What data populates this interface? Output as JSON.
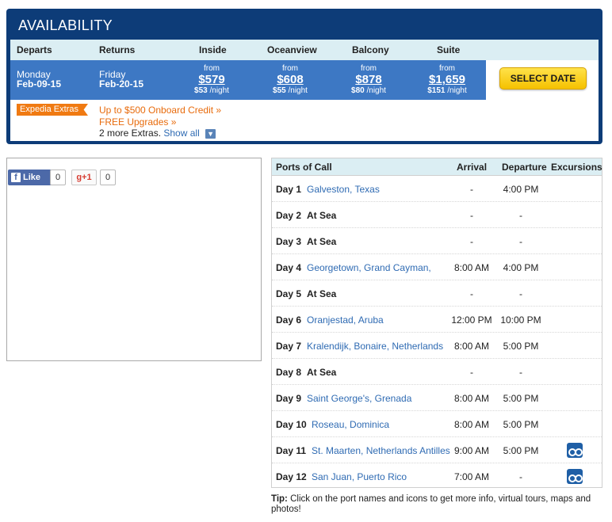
{
  "availability": {
    "title": "AVAILABILITY",
    "headers": {
      "departs": "Departs",
      "returns": "Returns",
      "inside": "Inside",
      "oceanview": "Oceanview",
      "balcony": "Balcony",
      "suite": "Suite"
    },
    "departs_day": "Monday",
    "departs_date": "Feb-09-15",
    "returns_day": "Friday",
    "returns_date": "Feb-20-15",
    "prices": [
      {
        "from": "from",
        "amount": "$579",
        "per_night_amount": "$53",
        "per_night_label": "/night"
      },
      {
        "from": "from",
        "amount": "$608",
        "per_night_amount": "$55",
        "per_night_label": "/night"
      },
      {
        "from": "from",
        "amount": "$878",
        "per_night_amount": "$80",
        "per_night_label": "/night"
      },
      {
        "from": "from",
        "amount": "$1,659",
        "per_night_amount": "$151",
        "per_night_label": "/night"
      }
    ],
    "select_date_label": "SELECT DATE",
    "extras_tag": "Expedia Extras",
    "extras": {
      "line1": "Up to $500 Onboard Credit »",
      "line2": "FREE Upgrades »",
      "more_text": "2 more Extras.",
      "show_all": "Show all"
    }
  },
  "social": {
    "like_label": "Like",
    "like_count": "0",
    "gplus_label": "+1",
    "gplus_count": "0"
  },
  "ports": {
    "headers": {
      "ports": "Ports of Call",
      "arrival": "Arrival",
      "departure": "Departure",
      "excursions": "Excursions"
    },
    "rows": [
      {
        "day": "Day 1",
        "port": "Galveston, Texas",
        "sea": false,
        "arrival": "-",
        "departure": "4:00 PM",
        "excursion": false
      },
      {
        "day": "Day 2",
        "port": "At Sea",
        "sea": true,
        "arrival": "-",
        "departure": "-",
        "excursion": false
      },
      {
        "day": "Day 3",
        "port": "At Sea",
        "sea": true,
        "arrival": "-",
        "departure": "-",
        "excursion": false
      },
      {
        "day": "Day 4",
        "port": "Georgetown, Grand Cayman,",
        "sea": false,
        "arrival": "8:00 AM",
        "departure": "4:00 PM",
        "excursion": false
      },
      {
        "day": "Day 5",
        "port": "At Sea",
        "sea": true,
        "arrival": "-",
        "departure": "-",
        "excursion": false
      },
      {
        "day": "Day 6",
        "port": "Oranjestad, Aruba",
        "sea": false,
        "arrival": "12:00 PM",
        "departure": "10:00 PM",
        "excursion": false
      },
      {
        "day": "Day 7",
        "port": "Kralendijk, Bonaire, Netherlands",
        "sea": false,
        "arrival": "8:00 AM",
        "departure": "5:00 PM",
        "excursion": false
      },
      {
        "day": "Day 8",
        "port": "At Sea",
        "sea": true,
        "arrival": "-",
        "departure": "-",
        "excursion": false
      },
      {
        "day": "Day 9",
        "port": "Saint George's, Grenada",
        "sea": false,
        "arrival": "8:00 AM",
        "departure": "5:00 PM",
        "excursion": false
      },
      {
        "day": "Day 10",
        "port": "Roseau, Dominica",
        "sea": false,
        "arrival": "8:00 AM",
        "departure": "5:00 PM",
        "excursion": false
      },
      {
        "day": "Day 11",
        "port": "St. Maarten, Netherlands Antilles",
        "sea": false,
        "arrival": "9:00 AM",
        "departure": "5:00 PM",
        "excursion": true
      },
      {
        "day": "Day 12",
        "port": "San Juan, Puerto Rico",
        "sea": false,
        "arrival": "7:00 AM",
        "departure": "-",
        "excursion": true
      }
    ]
  },
  "tip": {
    "label": "Tip:",
    "text": "Click on the port names and icons to get more info, virtual tours, maps and photos!"
  }
}
